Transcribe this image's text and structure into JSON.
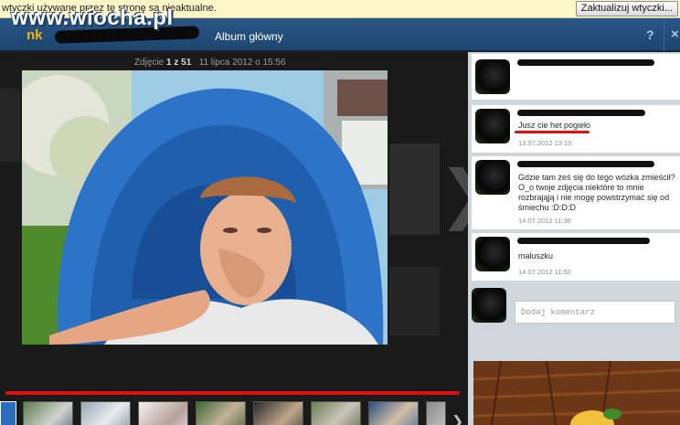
{
  "watermark": "www.wiocha.pl",
  "notice": {
    "text": "wtyczki używane przez tę stronę są nieaktualne.",
    "button": "Zaktualizuj wtyczki..."
  },
  "header": {
    "logo": "nk",
    "album_link": "Album główny",
    "help": "?",
    "close": "×"
  },
  "viewer": {
    "counter_prefix": "Zdjęcie",
    "counter_current": "1 z 51",
    "counter_date": "11 lipca 2012 o 15:56",
    "next": "❯",
    "thumb_next": "❯"
  },
  "comments": [
    {
      "text": "Jusz cie het pogieło",
      "date": "13.07.2012 13:10"
    },
    {
      "text": "Gdzie tam żeś się do tego wózka zmieścił? O_o twoje zdjęcia niektóre to mnie rozbrająją i nie mogę powstrzymać się od śmiechu :D:D:D",
      "date": "14.07.2012 11:36"
    },
    {
      "text": "maluszku",
      "date": "14.07.2012 11:50"
    }
  ],
  "add_comment_placeholder": "Dodaj komentarz",
  "colors": {
    "header": "#1d4570",
    "underline": "#e01010",
    "logo": "#f5b000"
  }
}
